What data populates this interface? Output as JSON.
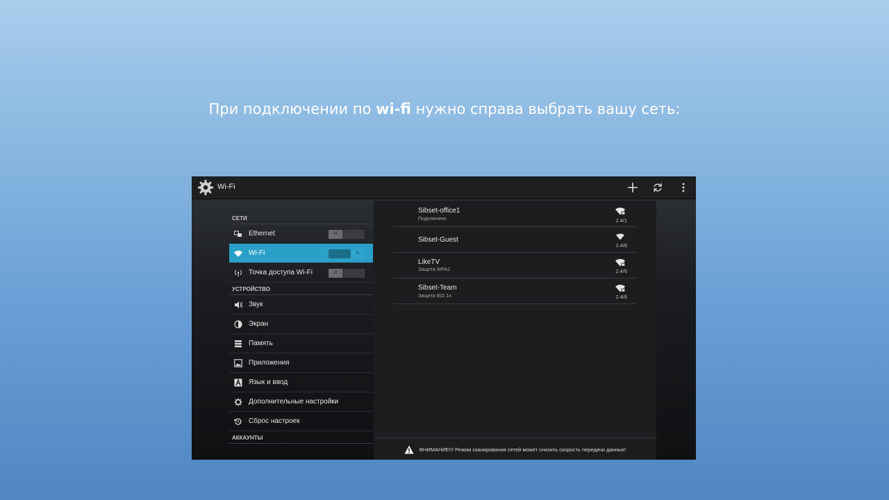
{
  "caption": {
    "before": "При подключении по ",
    "bold": "wi-fi",
    "after": " нужно справа выбрать вашу сеть:"
  },
  "actionbar": {
    "title": "Wi-Fi",
    "icons": [
      "gear-icon",
      "add-icon",
      "refresh-icon",
      "overflow-menu-icon"
    ]
  },
  "sidebar": {
    "sections": {
      "networks": "СЕТИ",
      "device": "УСТРОЙСТВО",
      "accounts": "АККАУНТЫ"
    },
    "network_items": [
      {
        "label": "Ethernet",
        "icon": "ethernet-icon",
        "toggle": "III",
        "on": false
      },
      {
        "label": "Wi-Fi",
        "icon": "wifi-icon",
        "toggle": "III",
        "on": true,
        "active": true
      },
      {
        "label": "Точка доступа Wi-Fi",
        "icon": "hotspot-icon",
        "toggle": "III",
        "on": false
      }
    ],
    "device_items": [
      {
        "label": "Звук",
        "icon": "sound-icon"
      },
      {
        "label": "Экран",
        "icon": "display-icon"
      },
      {
        "label": "Память",
        "icon": "storage-icon"
      },
      {
        "label": "Приложения",
        "icon": "apps-icon"
      },
      {
        "label": "Язык и ввод",
        "icon": "language-icon"
      },
      {
        "label": "Дополнительные настройки",
        "icon": "settings-icon"
      },
      {
        "label": "Сброс настроек",
        "icon": "reset-icon"
      }
    ]
  },
  "networks": [
    {
      "name": "Sibset-office1",
      "status": "Подключено",
      "band": "2.4/1",
      "secured": true
    },
    {
      "name": "Sibset-Guest",
      "status": "",
      "band": "2.4/6",
      "secured": false
    },
    {
      "name": "LikeTV",
      "status": "Защита WPA2",
      "band": "2.4/6",
      "secured": true
    },
    {
      "name": "Sibset-Team",
      "status": "Защита 802.1x",
      "band": "2.4/6",
      "secured": true
    }
  ],
  "warning": "ВНИМАНИЕ!!! Режим сканирования сетей может снизить скорость передачи данных!",
  "colors": {
    "accent": "#2aa0c8",
    "background": "#6aa0d6"
  }
}
